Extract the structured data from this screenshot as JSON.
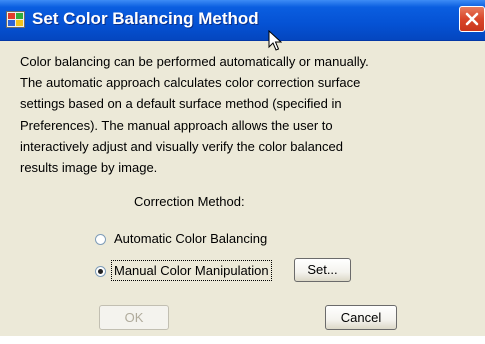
{
  "window": {
    "title": "Set Color Balancing Method",
    "app_icon": "color-balance-app-icon",
    "close_icon": "close-icon"
  },
  "description_lines": [
    "Color balancing can be performed automatically or manually.",
    "The automatic approach calculates color correction surface",
    "settings based on a default surface method (specified in",
    "Preferences). The manual approach allows the user to",
    "interactively adjust and visually verify the color balanced",
    "results image by image."
  ],
  "correction_method": {
    "label": "Correction Method:",
    "options": [
      {
        "label": "Automatic Color Balancing",
        "selected": false
      },
      {
        "label": "Manual Color Manipulation",
        "selected": true
      }
    ],
    "set_button": "Set..."
  },
  "buttons": {
    "ok": {
      "label": "OK",
      "enabled": false
    },
    "cancel": {
      "label": "Cancel",
      "enabled": true
    }
  }
}
